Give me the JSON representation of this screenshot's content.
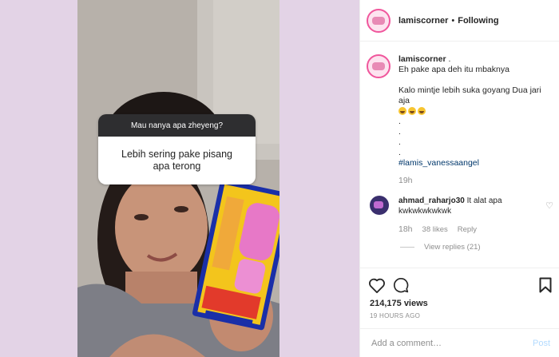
{
  "media": {
    "question_header": "Mau nanya apa zheyeng?",
    "answer_line1": "Lebih sering pake pisang",
    "answer_line2": "apa terong"
  },
  "header": {
    "username": "lamiscorner",
    "separator": "•",
    "follow_status": "Following"
  },
  "caption": {
    "username": "lamiscorner",
    "suffix": ".",
    "line1": "Eh pake apa deh itu mbaknya",
    "line2": "Kalo mintje lebih suka goyang Dua jari",
    "line3": "aja",
    "emojis": "grinning-squinting-face x3",
    "dots": [
      ".",
      ".",
      ".",
      "."
    ],
    "hashtag": "#lamis_vanessaangel",
    "time": "19h"
  },
  "comment": {
    "username": "ahmad_raharjo30",
    "text": "It alat apa kwkwkwkwkwk",
    "time": "18h",
    "likes": "38 likes",
    "reply_label": "Reply",
    "view_replies": "View replies (21)"
  },
  "footer": {
    "views": "214,175 views",
    "posted": "19 HOURS AGO",
    "add_comment_placeholder": "Add a comment…",
    "post_label": "Post"
  },
  "icons": {
    "like": "heart-icon",
    "comment": "comment-icon",
    "save": "bookmark-icon"
  },
  "colors": {
    "background": "#e3d3e6",
    "link": "#00376b",
    "muted": "#8e8e8e",
    "post_disabled": "#b3dbff"
  }
}
